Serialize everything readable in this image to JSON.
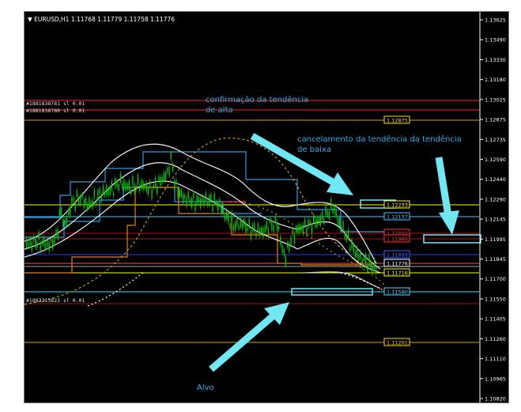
{
  "header": {
    "symbol": "EURUSD,H1",
    "ohlc": "1.11768 1.11779 1.11758 1.11776"
  },
  "orders": {
    "upper1": "#1881838781 sl",
    "upper1_lot": "0.01",
    "upper2": "#1881838780 sl",
    "upper2_lot": "0.01",
    "lower1": "#1883213823 sl",
    "lower1_lot": "0.01"
  },
  "annotations": {
    "confirmation": "confirmação da tendência\nde alta",
    "cancel": "cancelamento da tendência da tendência\nde baixa",
    "target": "Alvo"
  },
  "price_axis": {
    "ticks": [
      "1.13625",
      "1.13490",
      "1.13330",
      "1.13180",
      "1.13025",
      "1.12875",
      "1.12735",
      "1.12590",
      "1.12440",
      "1.12290",
      "1.12145",
      "1.11995",
      "1.11845",
      "1.11700",
      "1.11550",
      "1.11405",
      "1.11260",
      "1.11110",
      "1.10965",
      "1.10820"
    ]
  },
  "price_labels": [
    {
      "text": "1.12875",
      "color": "#ffd700"
    },
    {
      "text": "1.12233",
      "color": "#ffff00"
    },
    {
      "text": "1.12137",
      "color": "#40c4ff"
    },
    {
      "text": "1.12050",
      "color": "#ff3030"
    },
    {
      "text": "1.11989",
      "color": "#ff3030"
    },
    {
      "text": "1.11889",
      "color": "#4060ff"
    },
    {
      "text": "1.11776",
      "color": "#ffffff"
    },
    {
      "text": "1.11716",
      "color": "#ffff00"
    },
    {
      "text": "1.11580",
      "color": "#40e0ff"
    },
    {
      "text": "1.11201",
      "color": "#ffd700"
    }
  ],
  "colors": {
    "background": "#000000",
    "annotation": "#2ab0e8",
    "arrow": "#6fe8f4",
    "candle": "#00d000"
  }
}
